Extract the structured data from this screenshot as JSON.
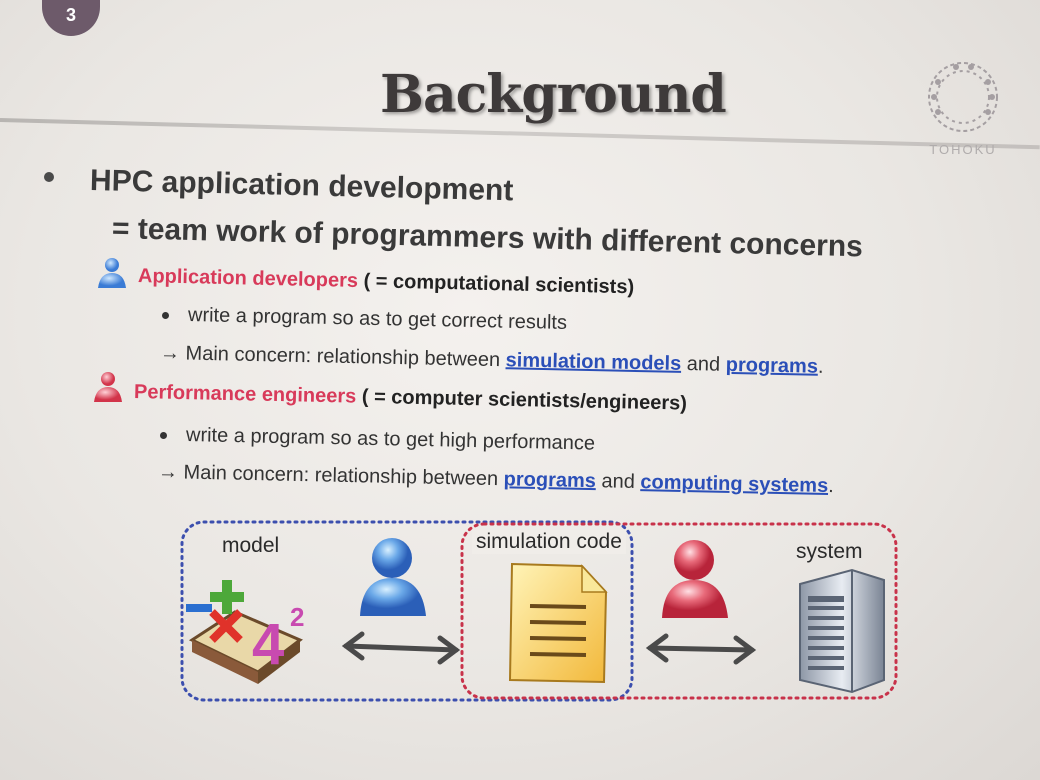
{
  "slide": {
    "page_number": "3",
    "title": "Background",
    "logo_text": "TOHOKU",
    "bullet_1": "HPC application development",
    "bullet_1_sub": "= team work of  programmers with different concerns",
    "roles": [
      {
        "name": "Application developers",
        "paren": "( = computational scientists)",
        "point": "write a program so as to get correct results",
        "concern_prefix": "→ Main concern: relationship between",
        "concern_link1": "simulation models",
        "concern_and": "and",
        "concern_link2": "programs",
        "concern_end": "."
      },
      {
        "name": "Performance engineers",
        "paren": "( = computer scientists/engineers)",
        "point": "write a program so as to get high performance",
        "concern_prefix": "→ Main concern: relationship between",
        "concern_link1": "programs",
        "concern_and": "and",
        "concern_link2": "computing systems",
        "concern_end": "."
      }
    ],
    "diagram": {
      "label_model": "model",
      "label_code": "simulation code",
      "label_system": "system"
    }
  },
  "colors": {
    "role_name": "#d83a5a",
    "link": "#2b4fb8",
    "blue_dotted": "#3c4fae",
    "red_dotted": "#c8324a"
  },
  "icons": [
    "person-blue-icon",
    "person-red-icon",
    "math-book-icon",
    "document-icon",
    "server-icon",
    "double-arrow-icon"
  ]
}
